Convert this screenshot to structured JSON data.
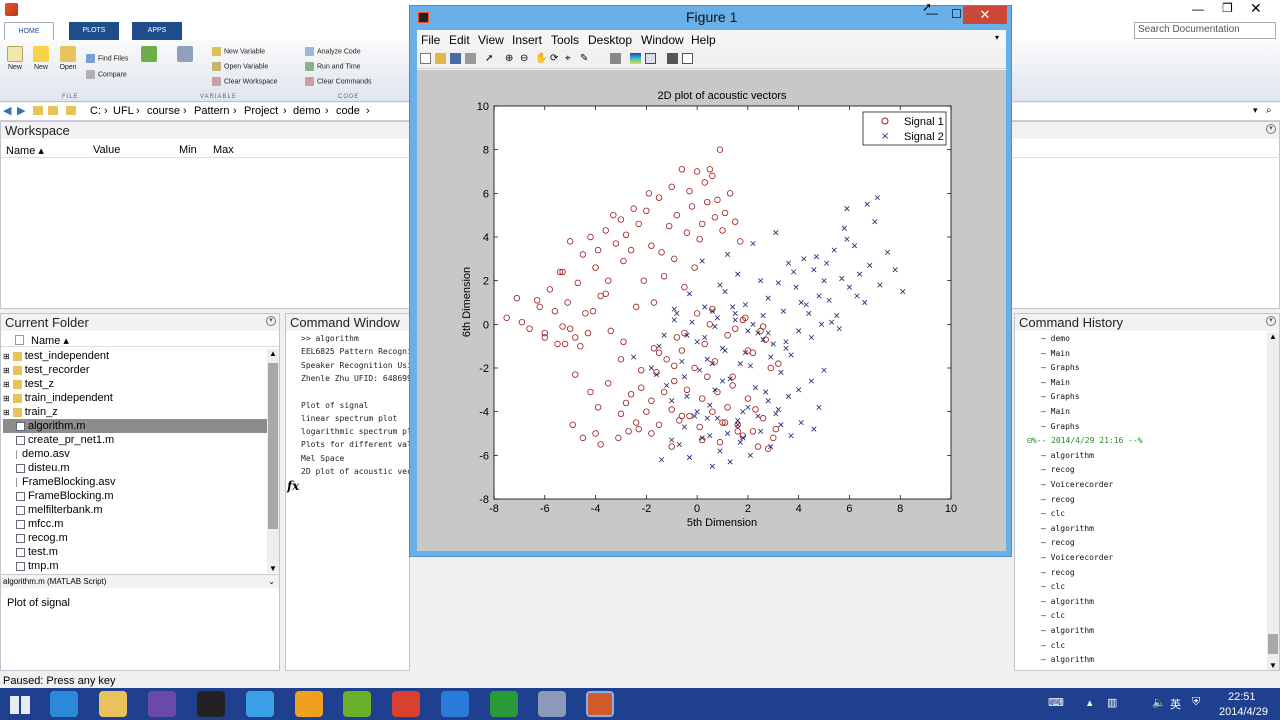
{
  "toolstrip": {
    "tabs": [
      "HOME",
      "PLOTS",
      "APPS"
    ],
    "buttons": {
      "new_script": "New\nScript",
      "new": "New",
      "open": "Open",
      "find_files": "Find Files",
      "compare": "Compare",
      "import_data": "Import\nData",
      "save_workspace": "Save\nWorkspace",
      "new_variable": "New Variable",
      "open_variable": "Open Variable",
      "clear_workspace": "Clear Workspace",
      "analyze_code": "Analyze Code",
      "run_and_time": "Run and Time",
      "clear_commands": "Clear Commands"
    },
    "groups": [
      "FILE",
      "VARIABLE",
      "CODE"
    ],
    "search_placeholder": "Search Documentation"
  },
  "address": {
    "crumbs": [
      "C:",
      "UFL",
      "course",
      "Pattern",
      "Project",
      "demo",
      "code"
    ]
  },
  "workspace": {
    "title": "Workspace",
    "columns": [
      "Name ▴",
      "Value",
      "Min",
      "Max"
    ]
  },
  "current_folder": {
    "title": "Current Folder",
    "header": "Name ▴",
    "items": [
      {
        "name": "test_independent",
        "type": "folder"
      },
      {
        "name": "test_recorder",
        "type": "folder"
      },
      {
        "name": "test_z",
        "type": "folder"
      },
      {
        "name": "train_independent",
        "type": "folder"
      },
      {
        "name": "train_z",
        "type": "folder"
      },
      {
        "name": "algorithm.m",
        "type": "m",
        "selected": true
      },
      {
        "name": "create_pr_net1.m",
        "type": "m"
      },
      {
        "name": "demo.asv",
        "type": "asv"
      },
      {
        "name": "disteu.m",
        "type": "m"
      },
      {
        "name": "FrameBlocking.asv",
        "type": "asv"
      },
      {
        "name": "FrameBlocking.m",
        "type": "m"
      },
      {
        "name": "melfilterbank.m",
        "type": "m"
      },
      {
        "name": "mfcc.m",
        "type": "m"
      },
      {
        "name": "recog.m",
        "type": "m"
      },
      {
        "name": "test.m",
        "type": "m"
      },
      {
        "name": "tmp.m",
        "type": "m"
      }
    ],
    "details_label": "algorithm.m (MATLAB Script)",
    "details_text": "Plot of signal"
  },
  "command_window": {
    "title": "Command Window",
    "lines": [
      ">> algorithm",
      "EEL6825 Pattern Recogni",
      "Speaker Recognition Usi",
      "Zhenle Zhu UFID: 648699",
      "",
      "Plot of signal",
      "linear spectrum plot",
      "logarithmic spectrum pl",
      "Plots for different val",
      "Mel Space",
      "2D plot of acoustic vec"
    ],
    "prompt": "fx"
  },
  "command_history": {
    "title": "Command History",
    "items": [
      {
        "text": "demo"
      },
      {
        "text": "Main"
      },
      {
        "text": "Graphs"
      },
      {
        "text": "Main"
      },
      {
        "text": "Graphs"
      },
      {
        "text": "Main"
      },
      {
        "text": "Graphs"
      },
      {
        "text": "%-- 2014/4/29 21:16 --%",
        "date": true
      },
      {
        "text": "algorithm"
      },
      {
        "text": "recog"
      },
      {
        "text": "Voicerecorder"
      },
      {
        "text": "recog"
      },
      {
        "text": "clc"
      },
      {
        "text": "algorithm"
      },
      {
        "text": "recog"
      },
      {
        "text": "Voicerecorder"
      },
      {
        "text": "recog"
      },
      {
        "text": "clc"
      },
      {
        "text": "algorithm"
      },
      {
        "text": "clc"
      },
      {
        "text": "algorithm"
      },
      {
        "text": "clc"
      },
      {
        "text": "algorithm"
      }
    ]
  },
  "figure": {
    "title": "Figure 1",
    "menus": [
      "File",
      "Edit",
      "View",
      "Insert",
      "Tools",
      "Desktop",
      "Window",
      "Help"
    ]
  },
  "status": "Paused: Press any key",
  "taskbar": {
    "time": "22:51",
    "date": "2014/4/29",
    "ime": "英"
  },
  "colors": {
    "signal1": "#a01818",
    "signal2": "#202070",
    "figure_frame": "#6ab0e8",
    "taskbar": "#1f3f8f"
  },
  "chart_data": {
    "type": "scatter",
    "title": "2D plot of acoustic vectors",
    "xlabel": "5th Dimension",
    "ylabel": "6th Dimension",
    "xlim": [
      -8,
      10
    ],
    "ylim": [
      -8,
      10
    ],
    "xticks": [
      -8,
      -6,
      -4,
      -2,
      0,
      2,
      4,
      6,
      8,
      10
    ],
    "yticks": [
      -8,
      -6,
      -4,
      -2,
      0,
      2,
      4,
      6,
      8,
      10
    ],
    "legend_position": "top-right",
    "series": [
      {
        "name": "Signal 1",
        "marker": "o",
        "color": "#a01818",
        "x": [
          -7.5,
          -7.1,
          -6.9,
          -6.6,
          -6.2,
          -6.0,
          -5.8,
          -5.6,
          -5.4,
          -5.3,
          -5.1,
          -5.0,
          -4.8,
          -4.7,
          -4.5,
          -4.4,
          -4.2,
          -4.0,
          -3.9,
          -3.8,
          -3.6,
          -3.5,
          -3.3,
          -3.2,
          -3.0,
          -2.9,
          -2.8,
          -2.6,
          -2.5,
          -2.4,
          -2.3,
          -2.1,
          -2.0,
          -1.9,
          -1.8,
          -1.7,
          -1.5,
          -1.4,
          -1.3,
          -1.1,
          -1.0,
          -0.9,
          -0.8,
          -0.6,
          -0.5,
          -0.4,
          -0.3,
          -0.2,
          -0.1,
          0.0,
          0.1,
          0.2,
          0.3,
          0.4,
          0.5,
          0.6,
          0.7,
          0.8,
          0.9,
          1.0,
          1.1,
          1.3,
          1.5,
          1.7,
          -4.8,
          -4.2,
          -3.9,
          -3.5,
          -3.0,
          -2.8,
          -2.6,
          -2.4,
          -2.2,
          -2.0,
          -1.8,
          -1.6,
          -1.5,
          -1.3,
          -1.2,
          -1.0,
          -0.9,
          -0.7,
          -0.6,
          -0.4,
          -0.3,
          -0.1,
          0.1,
          0.2,
          0.4,
          0.6,
          0.8,
          1.0,
          1.2,
          1.4,
          1.6,
          1.8,
          2.0,
          2.2,
          2.4,
          2.6,
          2.8,
          3.0,
          -6.0,
          -5.5,
          -5.0,
          -4.6,
          -4.3,
          -3.4,
          -2.9,
          -1.7,
          -0.8,
          0.3,
          1.5,
          2.2,
          2.7,
          3.2,
          -0.5,
          0.0,
          0.5,
          1.2,
          1.8,
          2.5,
          -3.0,
          -2.2,
          -1.5,
          -0.9,
          0.7,
          1.4,
          2.0,
          2.9,
          -4.9,
          -4.0,
          -3.1,
          -2.3,
          -1.0,
          0.2,
          0.9,
          1.6,
          -4.5,
          -3.8,
          -2.7,
          -1.8,
          -0.6,
          1.1,
          2.3,
          3.1,
          0.6,
          1.9,
          2.6,
          -5.3,
          -6.3,
          -5.2,
          -4.1,
          -3.6
        ],
        "y": [
          0.3,
          1.2,
          0.1,
          -0.2,
          0.8,
          -0.4,
          1.6,
          0.6,
          2.4,
          -0.1,
          1.0,
          3.8,
          -0.6,
          1.9,
          3.2,
          0.5,
          4.0,
          2.6,
          3.4,
          1.3,
          4.3,
          2.0,
          5.0,
          3.7,
          4.8,
          2.9,
          4.1,
          3.4,
          5.3,
          0.8,
          4.6,
          2.0,
          5.2,
          6.0,
          3.6,
          1.0,
          5.8,
          3.3,
          2.2,
          4.5,
          6.3,
          3.0,
          5.0,
          7.1,
          1.7,
          4.2,
          6.1,
          5.4,
          2.6,
          7.0,
          3.9,
          4.6,
          6.5,
          5.6,
          7.1,
          6.8,
          4.9,
          5.7,
          8.0,
          4.3,
          5.1,
          6.0,
          4.7,
          3.8,
          -2.3,
          -3.1,
          -3.8,
          -2.7,
          -4.1,
          -3.6,
          -3.2,
          -4.5,
          -2.9,
          -4.0,
          -3.5,
          -2.2,
          -4.6,
          -3.1,
          -1.6,
          -3.9,
          -2.6,
          -4.4,
          -1.2,
          -3.0,
          -4.2,
          -2.0,
          -4.7,
          -3.4,
          -2.4,
          -4.0,
          -3.1,
          -4.5,
          -3.8,
          -2.8,
          -4.6,
          -5.1,
          -3.4,
          -4.9,
          -5.6,
          -4.3,
          -5.7,
          -5.2,
          -0.6,
          -0.9,
          -0.2,
          -1.0,
          -0.4,
          -0.3,
          -0.8,
          -1.1,
          -0.6,
          -0.9,
          -0.2,
          -1.3,
          -0.7,
          -1.8,
          -0.4,
          0.5,
          0.0,
          -0.5,
          0.2,
          -0.3,
          -1.6,
          -2.1,
          -1.3,
          -1.9,
          -1.7,
          -2.4,
          -1.2,
          -2.0,
          -4.6,
          -5.0,
          -5.2,
          -4.8,
          -5.6,
          -5.3,
          -5.4,
          -4.9,
          -5.2,
          -5.5,
          -4.9,
          -5.0,
          -4.2,
          -4.5,
          -3.9,
          -4.8,
          0.7,
          0.3,
          -0.1,
          2.4,
          1.1,
          -0.9,
          0.6,
          1.4
        ]
      },
      {
        "name": "Signal 2",
        "marker": "x",
        "color": "#202070",
        "x": [
          -2.5,
          -1.8,
          -1.3,
          -1.0,
          -0.8,
          -0.5,
          -0.3,
          -0.1,
          0.0,
          0.2,
          0.4,
          0.6,
          0.7,
          0.9,
          1.0,
          1.2,
          1.3,
          1.5,
          1.6,
          1.8,
          1.9,
          2.1,
          2.2,
          2.4,
          2.5,
          2.7,
          2.8,
          3.0,
          3.1,
          3.3,
          3.4,
          3.6,
          3.7,
          3.9,
          4.0,
          4.2,
          4.3,
          4.5,
          4.6,
          4.8,
          4.9,
          5.1,
          5.2,
          5.4,
          5.5,
          5.7,
          5.8,
          6.0,
          6.2,
          6.4,
          6.6,
          6.8,
          7.0,
          7.2,
          7.5,
          7.8,
          8.1,
          -1.5,
          -1.2,
          -0.9,
          -0.6,
          -0.4,
          -0.2,
          0.1,
          0.3,
          0.5,
          0.8,
          1.0,
          1.1,
          1.4,
          1.6,
          1.7,
          2.0,
          2.3,
          2.6,
          2.9,
          3.2,
          3.5,
          3.8,
          4.1,
          4.4,
          4.7,
          5.0,
          5.3,
          5.6,
          5.9,
          6.3,
          -0.7,
          -0.3,
          0.2,
          0.6,
          0.9,
          1.3,
          1.7,
          2.1,
          2.5,
          2.9,
          3.3,
          3.7,
          4.1,
          4.6,
          -1.4,
          -1.0,
          -0.5,
          0.0,
          0.5,
          0.8,
          1.2,
          1.6,
          2.0,
          2.4,
          2.8,
          3.2,
          3.6,
          4.0,
          4.5,
          5.0,
          -0.9,
          -0.4,
          0.3,
          0.7,
          1.1,
          1.5,
          2.2,
          2.6,
          0.4,
          1.8,
          3.1,
          4.8,
          5.9,
          6.7,
          7.1,
          2.8,
          3.5,
          1.9,
          0.6,
          -1.6
        ],
        "y": [
          -1.5,
          -2.0,
          -0.5,
          -3.5,
          0.5,
          -2.4,
          1.4,
          -4.2,
          -0.8,
          2.9,
          -1.6,
          0.6,
          -3.0,
          1.8,
          -1.1,
          3.2,
          -2.5,
          0.2,
          2.3,
          -4.0,
          0.9,
          -1.9,
          3.7,
          -0.4,
          2.0,
          -3.1,
          1.2,
          -0.9,
          4.2,
          -2.2,
          0.6,
          2.8,
          -1.4,
          1.7,
          -0.3,
          3.0,
          0.9,
          -0.6,
          2.5,
          1.3,
          0.0,
          2.8,
          1.1,
          3.4,
          0.4,
          2.1,
          4.4,
          1.7,
          3.6,
          2.3,
          1.0,
          2.7,
          4.7,
          1.8,
          3.3,
          2.5,
          1.5,
          -1.0,
          -2.8,
          0.7,
          -1.7,
          -3.3,
          0.1,
          -2.1,
          -0.6,
          -3.7,
          0.3,
          -2.6,
          -1.2,
          0.8,
          -4.4,
          -1.8,
          -0.3,
          -2.9,
          0.4,
          -1.5,
          1.9,
          -0.8,
          2.4,
          1.0,
          0.5,
          3.1,
          2.0,
          0.1,
          -0.2,
          3.9,
          1.3,
          -5.5,
          -6.1,
          -5.2,
          -6.5,
          -5.8,
          -6.3,
          -5.4,
          -6.0,
          -4.9,
          -5.6,
          -4.6,
          -5.1,
          -4.5,
          -4.8,
          -6.2,
          -5.3,
          -4.7,
          -4.0,
          -5.1,
          -4.3,
          -5.0,
          -4.6,
          -3.8,
          -4.2,
          -3.5,
          -3.9,
          -3.3,
          -3.0,
          -2.6,
          -2.1,
          0.2,
          -0.5,
          0.8,
          -0.1,
          1.5,
          0.5,
          0.0,
          -0.7,
          -4.3,
          -5.2,
          -4.1,
          -3.8,
          5.3,
          5.5,
          5.8,
          -0.4,
          -1.1,
          -1.3,
          -1.8,
          -2.3
        ]
      }
    ]
  }
}
